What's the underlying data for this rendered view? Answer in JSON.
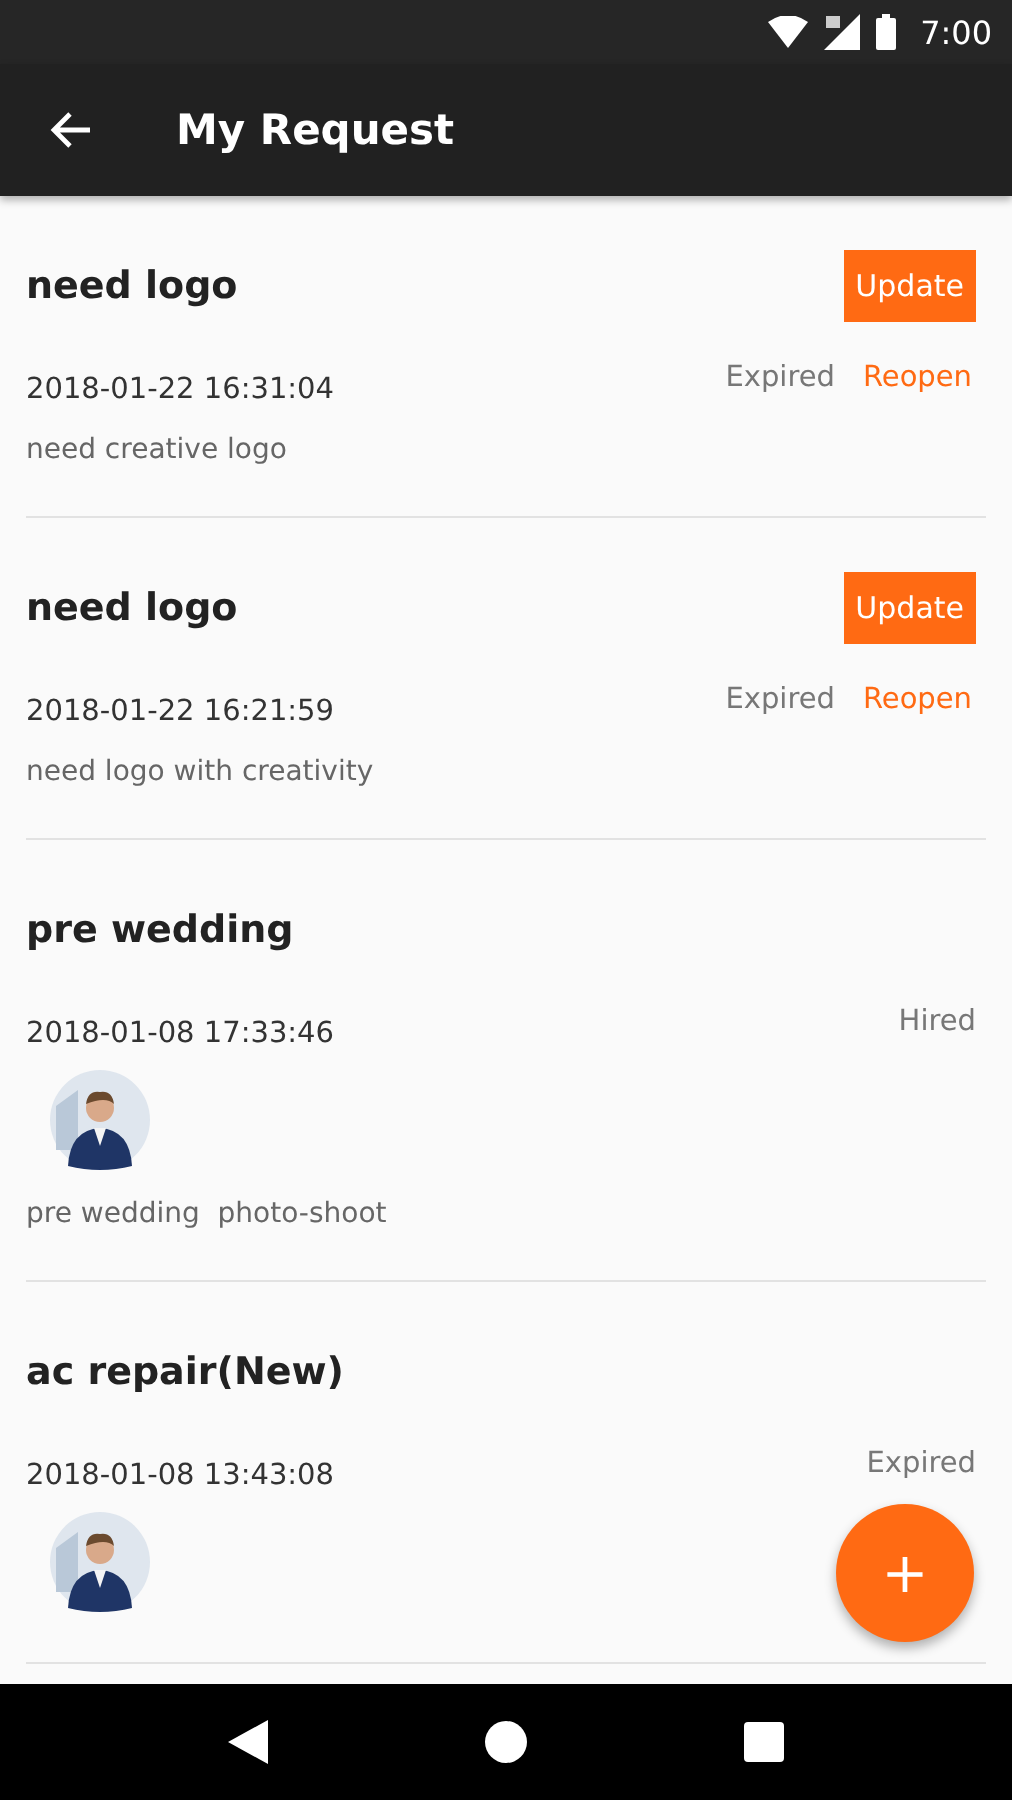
{
  "status_bar": {
    "time": "7:00"
  },
  "toolbar": {
    "title": "My Request"
  },
  "requests": [
    {
      "title": "need logo",
      "update_label": "Update",
      "date": "2018-01-22 16:31:04",
      "status": "Expired",
      "action": "Reopen",
      "description": "need creative logo"
    },
    {
      "title": "need logo",
      "update_label": "Update",
      "date": "2018-01-22 16:21:59",
      "status": "Expired",
      "action": "Reopen",
      "description": "need logo with creativity"
    },
    {
      "title": "pre wedding",
      "date": "2018-01-08 17:33:46",
      "status": "Hired",
      "description": "pre wedding  photo-shoot"
    },
    {
      "title": "ac repair(New)",
      "date": "2018-01-08 13:43:08",
      "status": "Expired"
    }
  ],
  "fab": {
    "label": "+"
  }
}
